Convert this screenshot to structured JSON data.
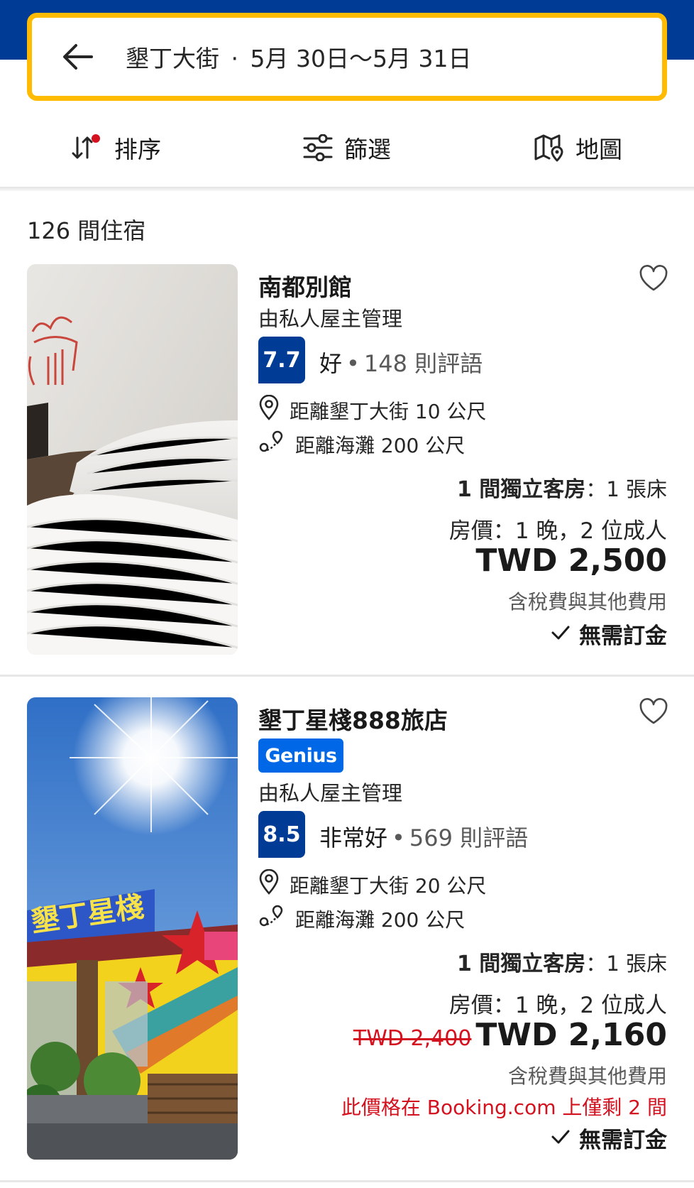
{
  "search": {
    "destination": "墾丁大街",
    "separator": "·",
    "dates": "5月 30日〜5月 31日"
  },
  "toolbar": {
    "sort_label": "排序",
    "filter_label": "篩選",
    "map_label": "地圖"
  },
  "colors": {
    "brand": "#003b95",
    "accent": "#febb02",
    "genius": "#0068e6",
    "alert": "#d4111e"
  },
  "results": {
    "count_text": "126 間住宿",
    "cards": [
      {
        "name": "南都別館",
        "host": "由私人屋主管理",
        "genius": null,
        "score": "7.7",
        "score_word": "好",
        "review_count": "148 則評語",
        "distance_center": "距離墾丁大街 10 公尺",
        "distance_beach": "距離海灘 200 公尺",
        "room_type": "1 間獨立客房",
        "beds": "1 張床",
        "stay": "房價：1 晚，2 位成人",
        "price": "TWD 2,500",
        "tax_note": "含稅費與其他費用",
        "no_deposit": "無需訂金"
      },
      {
        "name": "墾丁星棧888旅店",
        "host": "由私人屋主管理",
        "genius": "Genius",
        "score": "8.5",
        "score_word": "非常好",
        "review_count": "569 則評語",
        "distance_center": "距離墾丁大街 20 公尺",
        "distance_beach": "距離海灘 200 公尺",
        "room_type": "1 間獨立客房",
        "beds": "1 張床",
        "stay": "房價：1 晚，2 位成人",
        "original_price": "TWD 2,400",
        "price": "TWD 2,160",
        "tax_note": "含稅費與其他費用",
        "scarcity": "此價格在 Booking.com 上僅剩 2 間",
        "no_deposit": "無需訂金"
      }
    ]
  }
}
